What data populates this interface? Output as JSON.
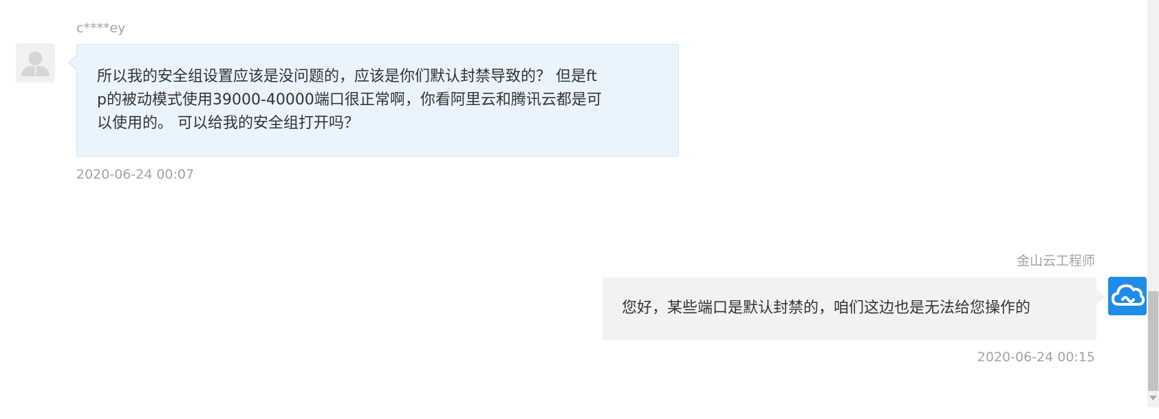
{
  "messages": [
    {
      "sender": "c****ey",
      "avatar_icon": "default-user-avatar-icon",
      "lines": [
        "所以我的安全组设置应该是没问题的，应该是你们默认封禁导致的？ 但是ft",
        "p的被动模式使用39000-40000端口很正常啊，你看阿里云和腾讯云都是可",
        "以使用的。 可以给我的安全组打开吗？"
      ],
      "time": "2020-06-24 00:07"
    },
    {
      "sender": "金山云工程师",
      "avatar_icon": "cloud-logo-icon",
      "text": "您好，某些端口是默认封禁的，咱们这边也是无法给您操作的",
      "time": "2020-06-24 00:15"
    }
  ],
  "colors": {
    "user_bubble": "#eaf4fc",
    "engineer_bubble": "#f2f2f2",
    "engineer_avatar": "#1e8ce8",
    "meta_text": "#a3a3a3"
  },
  "scrollbar": {
    "down_icon": "scroll-down-arrow-icon"
  }
}
